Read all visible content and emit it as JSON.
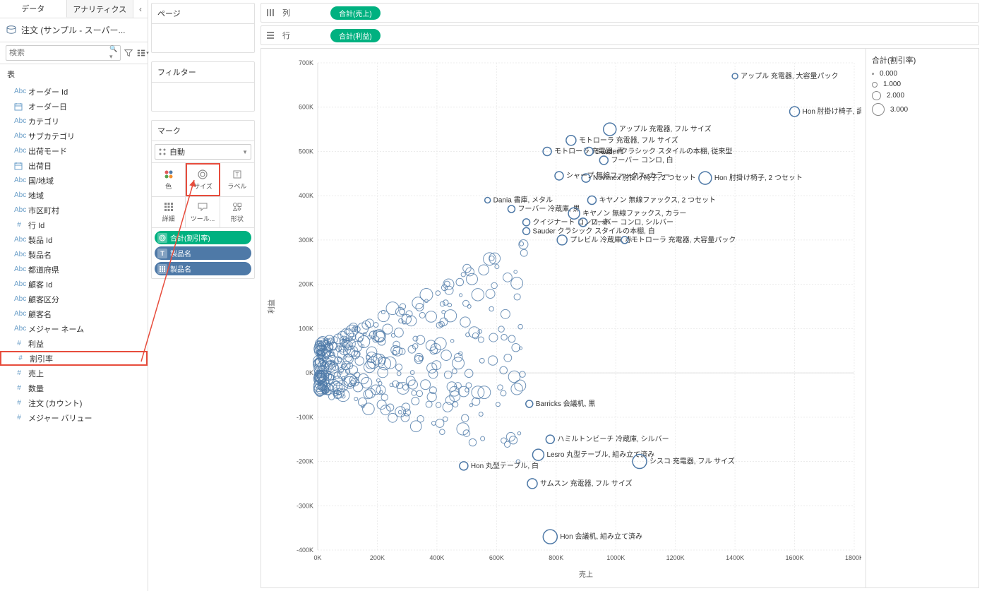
{
  "tabs": {
    "data": "データ",
    "analytics": "アナリティクス"
  },
  "datasource": "注文 (サンプル - スーパー...",
  "search_placeholder": "検索",
  "tables_label": "表",
  "fields": [
    {
      "type": "Abc",
      "name": "オーダー Id"
    },
    {
      "type": "date",
      "name": "オーダー日"
    },
    {
      "type": "Abc",
      "name": "カテゴリ"
    },
    {
      "type": "Abc",
      "name": "サブカテゴリ"
    },
    {
      "type": "Abc",
      "name": "出荷モード"
    },
    {
      "type": "date",
      "name": "出荷日"
    },
    {
      "type": "Abc",
      "name": "国/地域"
    },
    {
      "type": "Abc",
      "name": "地域"
    },
    {
      "type": "Abc",
      "name": "市区町村"
    },
    {
      "type": "#",
      "name": "行 Id"
    },
    {
      "type": "Abc",
      "name": "製品 Id"
    },
    {
      "type": "Abc",
      "name": "製品名"
    },
    {
      "type": "Abc",
      "name": "都道府県"
    },
    {
      "type": "Abc",
      "name": "顧客 Id"
    },
    {
      "type": "Abc",
      "name": "顧客区分"
    },
    {
      "type": "Abc",
      "name": "顧客名"
    },
    {
      "type": "Abc",
      "name": "メジャー ネーム"
    },
    {
      "type": "#",
      "name": "利益"
    },
    {
      "type": "#",
      "name": "割引率",
      "highlighted": true
    },
    {
      "type": "#",
      "name": "売上"
    },
    {
      "type": "#",
      "name": "数量"
    },
    {
      "type": "#",
      "name": "注文 (カウント)"
    },
    {
      "type": "#",
      "name": "メジャー バリュー"
    }
  ],
  "pages_label": "ページ",
  "filters_label": "フィルター",
  "marks_label": "マーク",
  "marks_type": "自動",
  "mark_buttons": {
    "color": "色",
    "size": "サイズ",
    "label": "ラベル",
    "detail": "詳細",
    "tooltip": "ツール...",
    "shape": "形状"
  },
  "mark_pills": [
    {
      "icon": "size",
      "color": "green",
      "label": "合計(割引率)"
    },
    {
      "icon": "T",
      "color": "blue",
      "label": "製品名"
    },
    {
      "icon": "detail",
      "color": "blue",
      "label": "製品名"
    }
  ],
  "columns_label": "列",
  "rows_label": "行",
  "columns_pill": "合計(売上)",
  "rows_pill": "合計(利益)",
  "legend": {
    "title": "合計(割引率)",
    "items": [
      {
        "size": 3,
        "label": "0.000"
      },
      {
        "size": 8,
        "label": "1.000"
      },
      {
        "size": 13,
        "label": "2.000"
      },
      {
        "size": 18,
        "label": "3.000"
      }
    ]
  },
  "chart_data": {
    "type": "scatter",
    "xlabel": "売上",
    "ylabel": "利益",
    "xlim": [
      0,
      1800000
    ],
    "ylim": [
      -400000,
      700000
    ],
    "x_ticks": [
      0,
      200000,
      400000,
      600000,
      800000,
      1000000,
      1200000,
      1400000,
      1600000,
      1800000
    ],
    "x_tick_labels": [
      "0K",
      "200K",
      "400K",
      "600K",
      "800K",
      "1000K",
      "1200K",
      "1400K",
      "1600K",
      "1800K"
    ],
    "y_ticks": [
      -400000,
      -300000,
      -200000,
      -100000,
      0,
      100000,
      200000,
      300000,
      400000,
      500000,
      600000,
      700000
    ],
    "y_tick_labels": [
      "-400K",
      "-300K",
      "-200K",
      "-100K",
      "0K",
      "100K",
      "200K",
      "300K",
      "400K",
      "500K",
      "600K",
      "700K"
    ],
    "labeled_points": [
      {
        "x": 1400000,
        "y": 670000,
        "r": 4,
        "label": "アップル 充電器, 大容量パック"
      },
      {
        "x": 1600000,
        "y": 590000,
        "r": 7,
        "label": "Hon 肘掛け椅子, 調整可能"
      },
      {
        "x": 900000,
        "y": 440000,
        "r": 6,
        "label": "Novimex 肘掛け椅子, 2 つセット"
      },
      {
        "x": 1300000,
        "y": 440000,
        "r": 9,
        "label": "Hon 肘掛け椅子, 2 つセット"
      },
      {
        "x": 700000,
        "y": 320000,
        "r": 5,
        "label": "Sauder クラシック スタイルの本棚, 白"
      },
      {
        "x": 820000,
        "y": 300000,
        "r": 7,
        "label": "プレビル 冷蔵庫, 赤"
      },
      {
        "x": 1030000,
        "y": 300000,
        "r": 5,
        "label": "モトローラ 充電器, 大容量パック"
      },
      {
        "x": 700000,
        "y": 340000,
        "r": 5,
        "label": "クイジナート コンロ, 赤"
      },
      {
        "x": 890000,
        "y": 340000,
        "r": 6,
        "label": "フーバー コンロ, シルバー"
      },
      {
        "x": 650000,
        "y": 370000,
        "r": 5,
        "label": "フーバー 冷蔵庫, 黒"
      },
      {
        "x": 860000,
        "y": 360000,
        "r": 8,
        "label": "キヤノン 無線ファックス, カラー"
      },
      {
        "x": 570000,
        "y": 390000,
        "r": 4,
        "label": "Dania 書庫, メタル"
      },
      {
        "x": 920000,
        "y": 390000,
        "r": 6,
        "label": "キヤノン 無線ファックス, 2 つセット"
      },
      {
        "x": 810000,
        "y": 445000,
        "r": 6,
        "label": "シャープ 無線ファックス, カラー"
      },
      {
        "x": 960000,
        "y": 480000,
        "r": 6,
        "label": "フーバー コンロ, 白"
      },
      {
        "x": 770000,
        "y": 500000,
        "r": 6,
        "label": "モトローラ 充電器, 青"
      },
      {
        "x": 910000,
        "y": 500000,
        "r": 6,
        "label": "Sauder クラシック スタイルの本棚, 従来型"
      },
      {
        "x": 850000,
        "y": 525000,
        "r": 7,
        "label": "モトローラ 充電器, フル サイズ"
      },
      {
        "x": 980000,
        "y": 550000,
        "r": 9,
        "label": "アップル 充電器, フル サイズ"
      },
      {
        "x": 710000,
        "y": -70000,
        "r": 5,
        "label": "Barricks 会議机, 黒"
      },
      {
        "x": 780000,
        "y": -150000,
        "r": 6,
        "label": "ハミルトンビーチ 冷蔵庫, シルバー"
      },
      {
        "x": 490000,
        "y": -210000,
        "r": 6,
        "label": "Hon 丸型テーブル, 白"
      },
      {
        "x": 740000,
        "y": -185000,
        "r": 8,
        "label": "Lesro 丸型テーブル, 組み立て済み"
      },
      {
        "x": 1080000,
        "y": -200000,
        "r": 10,
        "label": "シスコ 充電器, フル サイズ"
      },
      {
        "x": 720000,
        "y": -250000,
        "r": 7,
        "label": "サムスン 充電器, フル サイズ"
      },
      {
        "x": 780000,
        "y": -370000,
        "r": 10,
        "label": "Hon 会議机, 組み立て済み"
      }
    ],
    "cloud": {
      "count": 380,
      "x_range": [
        5000,
        700000
      ],
      "y_range": [
        -200000,
        250000
      ],
      "r_range": [
        2,
        9
      ]
    }
  }
}
